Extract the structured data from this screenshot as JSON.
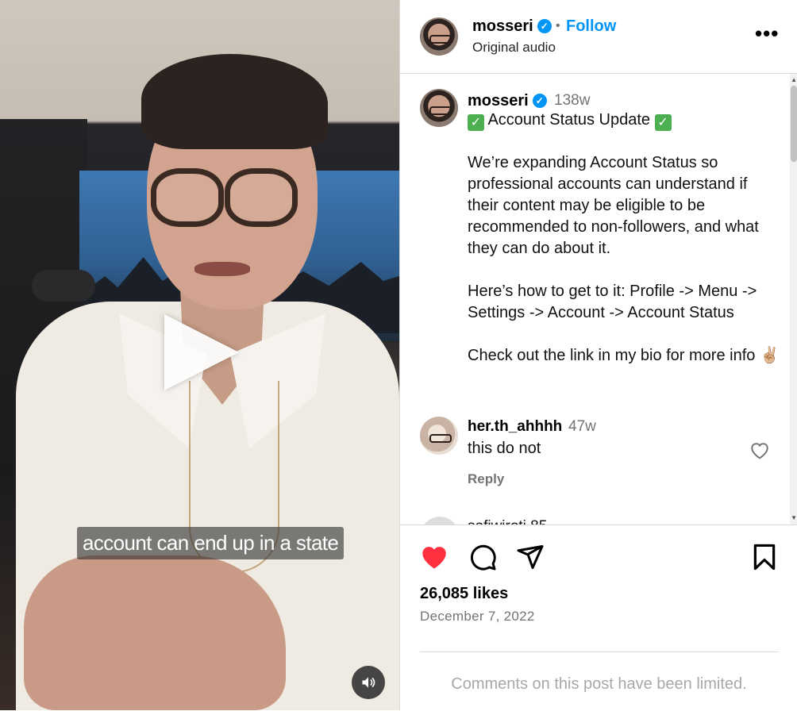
{
  "media": {
    "caption_overlay": "account can end up in a state",
    "play_icon": "play-icon",
    "sound_icon": "speaker-icon"
  },
  "header": {
    "username": "mosseri",
    "verified": true,
    "separator": "•",
    "follow_label": "Follow",
    "subtitle": "Original audio",
    "more_icon": "more-options-icon",
    "more_label": "•••"
  },
  "post_caption": {
    "username": "mosseri",
    "time": "138w",
    "title": "Account Status Update",
    "title_emoji": "✅",
    "paragraph1": "We’re expanding Account Status so professional accounts can understand if their content may be eligible to be recommended to non-followers, and what they can do about it.",
    "paragraph2": "Here’s how to get to it: Profile -> Menu -> Settings -> Account -> Account Status",
    "paragraph3": "Check out the link in my bio for more info ✌🏼"
  },
  "comments": [
    {
      "username": "her.th_ahhhh",
      "time": "47w",
      "text": "this do not",
      "reply_label": "Reply"
    }
  ],
  "partial_comment_text": "sofiwiroti  85",
  "actions": {
    "like_icon": "heart-filled-icon",
    "comment_icon": "comment-icon",
    "share_icon": "share-icon",
    "save_icon": "bookmark-icon",
    "like_color": "#ff3040"
  },
  "likes": "26,085 likes",
  "date": "December 7, 2022",
  "comments_limited": "Comments on this post have been limited."
}
